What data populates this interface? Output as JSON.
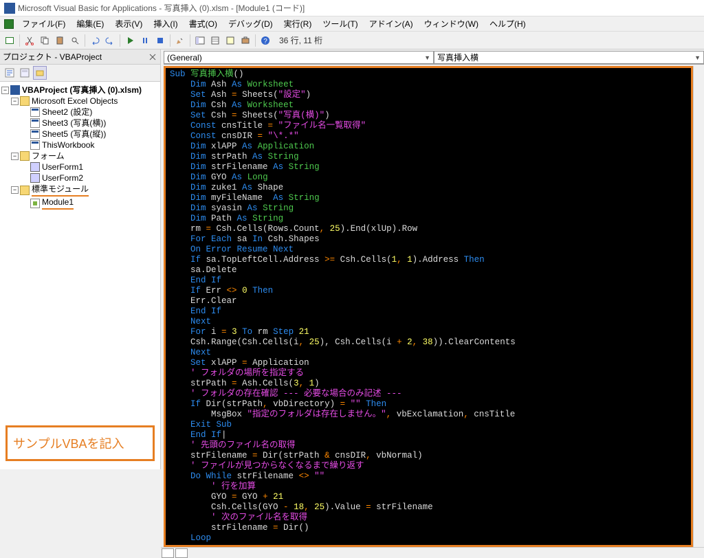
{
  "title": "Microsoft Visual Basic for Applications - 写真挿入 (0).xlsm - [Module1 (コード)]",
  "menu": {
    "file": "ファイル(F)",
    "edit": "編集(E)",
    "view": "表示(V)",
    "insert": "挿入(I)",
    "format": "書式(O)",
    "debug": "デバッグ(D)",
    "run": "実行(R)",
    "tools": "ツール(T)",
    "addins": "アドイン(A)",
    "window": "ウィンドウ(W)",
    "help": "ヘルプ(H)"
  },
  "toolbar": {
    "position": "36 行, 11 桁"
  },
  "project_panel": {
    "title": "プロジェクト - VBAProject",
    "root": "VBAProject (写真挿入 (0).xlsm)",
    "excel_objects": "Microsoft Excel Objects",
    "sheets": [
      "Sheet2 (設定)",
      "Sheet3 (写真(横))",
      "Sheet5 (写真(縦))",
      "ThisWorkbook"
    ],
    "forms_folder": "フォーム",
    "forms": [
      "UserForm1",
      "UserForm2"
    ],
    "modules_folder": "標準モジュール",
    "modules": [
      "Module1"
    ]
  },
  "annotation": "サンプルVBAを記入",
  "dropdowns": {
    "left": "(General)",
    "right": "写真挿入横"
  },
  "code_lines": [
    {
      "i": 0,
      "t": [
        [
          "kw",
          "Sub"
        ],
        [
          "fn",
          " 写真挿入横"
        ],
        [
          "id",
          "()"
        ]
      ]
    },
    {
      "i": 1,
      "t": [
        [
          "kw",
          "Dim"
        ],
        [
          "id",
          " Ash "
        ],
        [
          "kw",
          "As"
        ],
        [
          "fn",
          " Worksheet"
        ]
      ]
    },
    {
      "i": 1,
      "t": [
        [
          "kw",
          "Set"
        ],
        [
          "id",
          " Ash "
        ],
        [
          "op",
          "="
        ],
        [
          "id",
          " Sheets("
        ],
        [
          "str",
          "\"設定\""
        ],
        [
          "id",
          ")"
        ]
      ]
    },
    {
      "i": 1,
      "t": [
        [
          "kw",
          "Dim"
        ],
        [
          "id",
          " Csh "
        ],
        [
          "kw",
          "As"
        ],
        [
          "fn",
          " Worksheet"
        ]
      ]
    },
    {
      "i": 1,
      "t": [
        [
          "kw",
          "Set"
        ],
        [
          "id",
          " Csh "
        ],
        [
          "op",
          "="
        ],
        [
          "id",
          " Sheets("
        ],
        [
          "str",
          "\"写真(横)\""
        ],
        [
          "id",
          ")"
        ]
      ]
    },
    {
      "i": 1,
      "t": [
        [
          "kw",
          "Const"
        ],
        [
          "id",
          " cnsTitle "
        ],
        [
          "op",
          "="
        ],
        [
          "str",
          " \"ファイル名一覧取得\""
        ]
      ]
    },
    {
      "i": 1,
      "t": [
        [
          "kw",
          "Const"
        ],
        [
          "id",
          " cnsDIR "
        ],
        [
          "op",
          "="
        ],
        [
          "str",
          " \"\\*.*\""
        ]
      ]
    },
    {
      "i": 1,
      "t": [
        [
          "kw",
          "Dim"
        ],
        [
          "id",
          " xlAPP "
        ],
        [
          "kw",
          "As"
        ],
        [
          "fn",
          " Application"
        ]
      ]
    },
    {
      "i": 1,
      "t": [
        [
          "kw",
          "Dim"
        ],
        [
          "id",
          " strPath "
        ],
        [
          "kw",
          "As"
        ],
        [
          "fn",
          " String"
        ]
      ]
    },
    {
      "i": 1,
      "t": [
        [
          "kw",
          "Dim"
        ],
        [
          "id",
          " strFilename "
        ],
        [
          "kw",
          "As"
        ],
        [
          "fn",
          " String"
        ]
      ]
    },
    {
      "i": 1,
      "t": [
        [
          "kw",
          "Dim"
        ],
        [
          "id",
          " GYO "
        ],
        [
          "kw",
          "As"
        ],
        [
          "fn",
          " Long"
        ]
      ]
    },
    {
      "i": 1,
      "t": [
        [
          "kw",
          "Dim"
        ],
        [
          "id",
          " zuke1 "
        ],
        [
          "kw",
          "As"
        ],
        [
          "id",
          " Shape"
        ]
      ]
    },
    {
      "i": 1,
      "t": [
        [
          "kw",
          "Dim"
        ],
        [
          "id",
          " myFileName  "
        ],
        [
          "kw",
          "As"
        ],
        [
          "fn",
          " String"
        ]
      ]
    },
    {
      "i": 1,
      "t": [
        [
          "kw",
          "Dim"
        ],
        [
          "id",
          " syasin "
        ],
        [
          "kw",
          "As"
        ],
        [
          "fn",
          " String"
        ]
      ]
    },
    {
      "i": 1,
      "t": [
        [
          "kw",
          "Dim"
        ],
        [
          "id",
          " Path "
        ],
        [
          "kw",
          "As"
        ],
        [
          "fn",
          " String"
        ]
      ]
    },
    {
      "i": 1,
      "t": [
        [
          "id",
          "rm "
        ],
        [
          "op",
          "="
        ],
        [
          "id",
          " Csh.Cells(Rows.Count"
        ],
        [
          "op",
          ","
        ],
        [
          "num",
          " 25"
        ],
        [
          "id",
          ").End(xlUp).Row"
        ]
      ]
    },
    {
      "i": 1,
      "t": [
        [
          "kw",
          "For Each"
        ],
        [
          "id",
          " sa "
        ],
        [
          "kw",
          "In"
        ],
        [
          "id",
          " Csh.Shapes"
        ]
      ]
    },
    {
      "i": 1,
      "t": [
        [
          "kw",
          "On Error Resume Next"
        ]
      ]
    },
    {
      "i": 1,
      "t": [
        [
          "kw",
          "If"
        ],
        [
          "id",
          " sa.TopLeftCell.Address "
        ],
        [
          "op",
          ">="
        ],
        [
          "id",
          " Csh.Cells("
        ],
        [
          "num",
          "1"
        ],
        [
          "op",
          ","
        ],
        [
          "num",
          " 1"
        ],
        [
          "id",
          ").Address "
        ],
        [
          "kw",
          "Then"
        ]
      ]
    },
    {
      "i": 1,
      "t": [
        [
          "id",
          "sa.Delete"
        ]
      ]
    },
    {
      "i": 1,
      "t": [
        [
          "kw",
          "End If"
        ]
      ]
    },
    {
      "i": 1,
      "t": [
        [
          "kw",
          "If"
        ],
        [
          "id",
          " Err "
        ],
        [
          "op",
          "<>"
        ],
        [
          "num",
          " 0 "
        ],
        [
          "kw",
          "Then"
        ]
      ]
    },
    {
      "i": 1,
      "t": [
        [
          "id",
          "Err.Clear"
        ]
      ]
    },
    {
      "i": 1,
      "t": [
        [
          "kw",
          "End If"
        ]
      ]
    },
    {
      "i": 1,
      "t": [
        [
          "kw",
          "Next"
        ]
      ]
    },
    {
      "i": 1,
      "t": [
        [
          "kw",
          "For"
        ],
        [
          "id",
          " i "
        ],
        [
          "op",
          "="
        ],
        [
          "num",
          " 3 "
        ],
        [
          "kw",
          "To"
        ],
        [
          "id",
          " rm "
        ],
        [
          "kw",
          "Step"
        ],
        [
          "num",
          " 21"
        ]
      ]
    },
    {
      "i": 1,
      "t": [
        [
          "id",
          "Csh.Range(Csh.Cells(i"
        ],
        [
          "op",
          ","
        ],
        [
          "num",
          " 25"
        ],
        [
          "id",
          "), Csh.Cells(i "
        ],
        [
          "op",
          "+"
        ],
        [
          "num",
          " 2"
        ],
        [
          "op",
          ","
        ],
        [
          "num",
          " 38"
        ],
        [
          "id",
          ")).ClearContents"
        ]
      ]
    },
    {
      "i": 1,
      "t": [
        [
          "kw",
          "Next"
        ]
      ]
    },
    {
      "i": 1,
      "t": [
        [
          "kw",
          "Set"
        ],
        [
          "id",
          " xlAPP "
        ],
        [
          "op",
          "="
        ],
        [
          "id",
          " Application"
        ]
      ]
    },
    {
      "i": 1,
      "t": [
        [
          "cmt",
          "' フォルダの場所を指定する"
        ]
      ]
    },
    {
      "i": 1,
      "t": [
        [
          "id",
          "strPath "
        ],
        [
          "op",
          "="
        ],
        [
          "id",
          " Ash.Cells("
        ],
        [
          "num",
          "3"
        ],
        [
          "op",
          ","
        ],
        [
          "num",
          " 1"
        ],
        [
          "id",
          ")"
        ]
      ]
    },
    {
      "i": 1,
      "t": [
        [
          "cmt",
          "' フォルダの存在確認 --- 必要な場合のみ記述 ---"
        ]
      ]
    },
    {
      "i": 1,
      "t": [
        [
          "kw",
          "If"
        ],
        [
          "id",
          " Dir(strPath"
        ],
        [
          "op",
          ","
        ],
        [
          "id",
          " vbDirectory) "
        ],
        [
          "op",
          "="
        ],
        [
          "str",
          " \"\" "
        ],
        [
          "kw",
          "Then"
        ]
      ]
    },
    {
      "i": 2,
      "t": [
        [
          "id",
          "MsgBox "
        ],
        [
          "str",
          "\"指定のフォルダは存在しません。\""
        ],
        [
          "op",
          ","
        ],
        [
          "id",
          " vbExclamation"
        ],
        [
          "op",
          ","
        ],
        [
          "id",
          " cnsTitle"
        ]
      ]
    },
    {
      "i": 1,
      "t": [
        [
          "kw",
          "Exit Sub"
        ]
      ]
    },
    {
      "i": 1,
      "t": [
        [
          "kw",
          "End If"
        ],
        [
          "id",
          "|"
        ]
      ]
    },
    {
      "i": 1,
      "t": [
        [
          "cmt",
          "' 先頭のファイル名の取得"
        ]
      ]
    },
    {
      "i": 1,
      "t": [
        [
          "id",
          "strFilename "
        ],
        [
          "op",
          "="
        ],
        [
          "id",
          " Dir(strPath "
        ],
        [
          "op",
          "&"
        ],
        [
          "id",
          " cnsDIR"
        ],
        [
          "op",
          ","
        ],
        [
          "id",
          " vbNormal)"
        ]
      ]
    },
    {
      "i": 1,
      "t": [
        [
          "cmt",
          "' ファイルが見つからなくなるまで繰り返す"
        ]
      ]
    },
    {
      "i": 1,
      "t": [
        [
          "kw",
          "Do While"
        ],
        [
          "id",
          " strFilename "
        ],
        [
          "op",
          "<>"
        ],
        [
          "str",
          " \"\""
        ]
      ]
    },
    {
      "i": 2,
      "t": [
        [
          "cmt",
          "' 行を加算"
        ]
      ]
    },
    {
      "i": 2,
      "t": [
        [
          "id",
          "GYO "
        ],
        [
          "op",
          "="
        ],
        [
          "id",
          " GYO "
        ],
        [
          "op",
          "+"
        ],
        [
          "num",
          " 21"
        ]
      ]
    },
    {
      "i": 2,
      "t": [
        [
          "id",
          "Csh.Cells(GYO "
        ],
        [
          "op",
          "-"
        ],
        [
          "num",
          " 18"
        ],
        [
          "op",
          ","
        ],
        [
          "num",
          " 25"
        ],
        [
          "id",
          ").Value "
        ],
        [
          "op",
          "="
        ],
        [
          "id",
          " strFilename"
        ]
      ]
    },
    {
      "i": 2,
      "t": [
        [
          "cmt",
          "' 次のファイル名を取得"
        ]
      ]
    },
    {
      "i": 2,
      "t": [
        [
          "id",
          "strFilename "
        ],
        [
          "op",
          "="
        ],
        [
          "id",
          " Dir()"
        ]
      ]
    },
    {
      "i": 1,
      "t": [
        [
          "kw",
          "Loop"
        ]
      ]
    }
  ]
}
